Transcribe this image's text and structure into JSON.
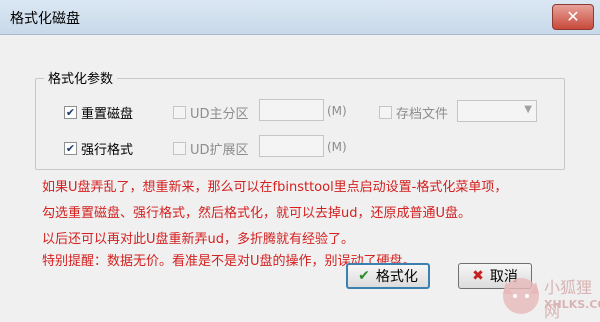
{
  "window": {
    "title": "格式化磁盘",
    "close_glyph": "✕"
  },
  "group": {
    "title": "格式化参数",
    "options": {
      "reset_disk": {
        "label": "重置磁盘",
        "checked": true
      },
      "ud_primary": {
        "label": "UD主分区",
        "unit": "(M)"
      },
      "archive_file": {
        "label": "存档文件"
      },
      "force_format": {
        "label": "强行格式",
        "checked": true
      },
      "ud_extended": {
        "label": "UD扩展区",
        "unit": "(M)"
      }
    }
  },
  "notes": {
    "line1": "如果U盘弄乱了，想重新来，那么可以在fbinsttool里点启动设置-格式化菜单项，",
    "line2": "勾选重置磁盘、强行格式，然后格式化，就可以去掉ud，还原成普通U盘。",
    "line3": "以后还可以再对此U盘重新弄ud，多折腾就有经验了。",
    "line4": "特别提醒：数据无价。看准是不是对U盘的操作，别误动了硬盘。"
  },
  "buttons": {
    "format": {
      "label": "格式化",
      "icon": "✔"
    },
    "cancel": {
      "label": "取消",
      "icon": "✖"
    }
  },
  "watermark": {
    "name": "小狐狸网",
    "site": "XHLKS.COM"
  },
  "colors": {
    "note_text": "#d42020",
    "accent": "#3c7fb1"
  }
}
